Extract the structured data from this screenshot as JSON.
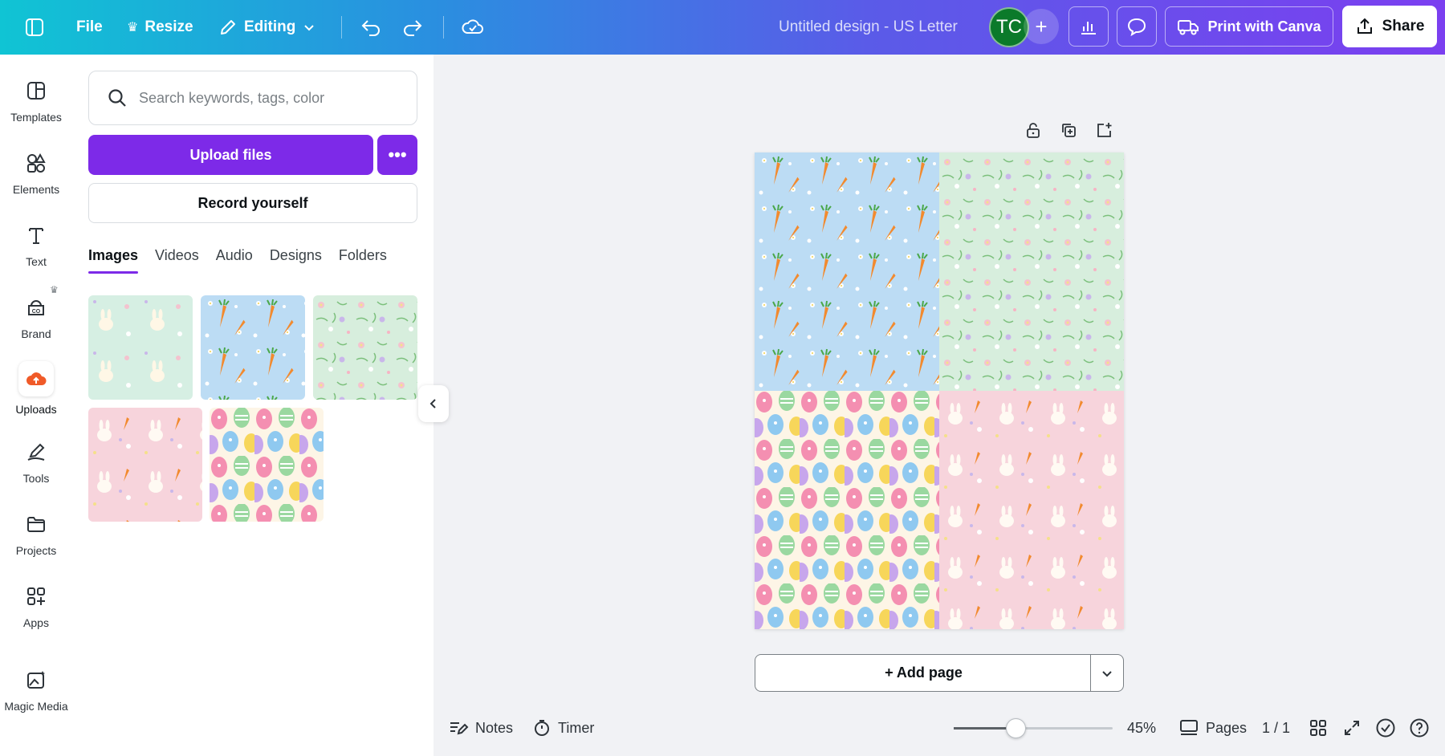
{
  "topbar": {
    "file_label": "File",
    "resize_label": "Resize",
    "editing_label": "Editing",
    "doc_title": "Untitled design - US Letter",
    "avatar_initials": "TC",
    "print_label": "Print with Canva",
    "share_label": "Share"
  },
  "rail": {
    "items": [
      {
        "label": "Templates",
        "icon": "templates-icon"
      },
      {
        "label": "Elements",
        "icon": "elements-icon"
      },
      {
        "label": "Text",
        "icon": "text-icon"
      },
      {
        "label": "Brand",
        "icon": "brand-icon"
      },
      {
        "label": "Uploads",
        "icon": "uploads-icon"
      },
      {
        "label": "Tools",
        "icon": "tools-icon"
      },
      {
        "label": "Projects",
        "icon": "projects-icon"
      },
      {
        "label": "Apps",
        "icon": "apps-icon"
      },
      {
        "label": "Magic Media",
        "icon": "magic-media-icon"
      }
    ]
  },
  "panel": {
    "search_placeholder": "Search keywords, tags, color",
    "upload_label": "Upload files",
    "record_label": "Record yourself",
    "tabs": [
      "Images",
      "Videos",
      "Audio",
      "Designs",
      "Folders"
    ],
    "active_tab": "Images",
    "thumbnails": [
      {
        "pattern": "bunnies-mint"
      },
      {
        "pattern": "carrots-blue"
      },
      {
        "pattern": "floral-mint"
      },
      {
        "pattern": "bunnies-pink"
      },
      {
        "pattern": "easter-eggs"
      }
    ]
  },
  "canvas": {
    "add_page_label": "+ Add page"
  },
  "bottombar": {
    "notes_label": "Notes",
    "timer_label": "Timer",
    "zoom": "45%",
    "zoom_fraction": 0.39,
    "pages_label": "Pages",
    "page_count": "1 / 1"
  },
  "colors": {
    "accent": "#7d2ae8",
    "avatar": "#0b7a2a",
    "uploads_icon": "#f05a28"
  }
}
